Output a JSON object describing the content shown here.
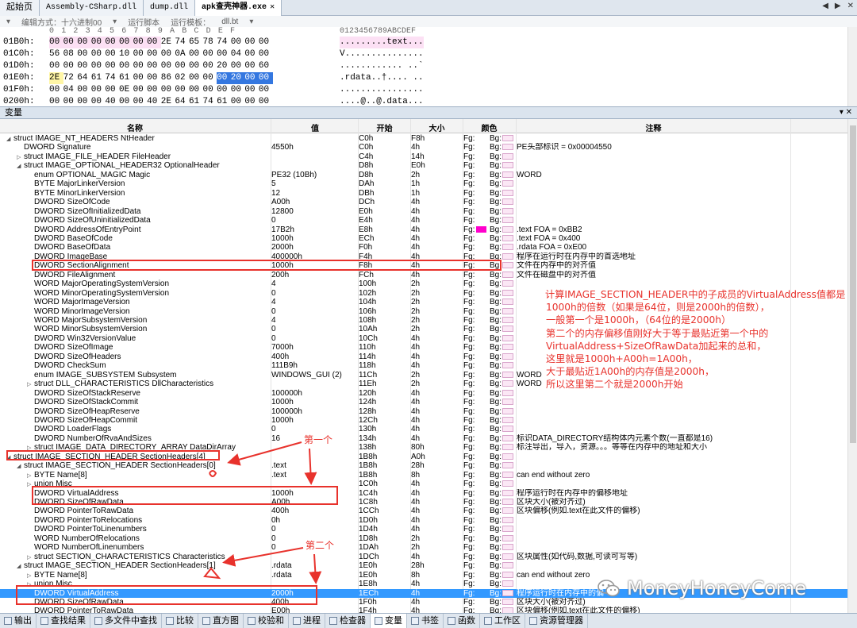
{
  "tabs": [
    {
      "label": "起始页",
      "active": false
    },
    {
      "label": "Assembly-CSharp.dll",
      "active": false
    },
    {
      "label": "dump.dll",
      "active": false
    },
    {
      "label": "apk查壳神器.exe",
      "active": true
    }
  ],
  "hex_toolbar": {
    "edit_mode": "编辑方式：十六进制00",
    "run_script": "运行脚本",
    "run_template": "运行模板：",
    "template_value": "dll.bt"
  },
  "hex": {
    "header_cols": "0  1  2  3  4  5  6  7  8  9  A  B  C  D  E  F",
    "header_ascii": "0123456789ABCDEF",
    "rows": [
      {
        "addr": "01B0h:",
        "bytes": [
          "00",
          "00",
          "00",
          "00",
          "00",
          "00",
          "00",
          "00",
          "2E",
          "74",
          "65",
          "78",
          "74",
          "00",
          "00",
          "00"
        ],
        "ascii": ".........text...",
        "style": "pink8"
      },
      {
        "addr": "01C0h:",
        "bytes": [
          "56",
          "08",
          "00",
          "00",
          "00",
          "10",
          "00",
          "00",
          "00",
          "0A",
          "00",
          "00",
          "00",
          "04",
          "00",
          "00"
        ],
        "ascii": "V...............",
        "style": "none"
      },
      {
        "addr": "01D0h:",
        "bytes": [
          "00",
          "00",
          "00",
          "00",
          "00",
          "00",
          "00",
          "00",
          "00",
          "00",
          "00",
          "00",
          "20",
          "00",
          "00",
          "60"
        ],
        "ascii": "............ ..`",
        "style": "none"
      },
      {
        "addr": "01E0h:",
        "bytes": [
          "2E",
          "72",
          "64",
          "61",
          "74",
          "61",
          "00",
          "00",
          "86",
          "02",
          "00",
          "00",
          "00",
          "20",
          "00",
          "00"
        ],
        "ascii": ".rdata..†.... ..",
        "style": "rdata"
      },
      {
        "addr": "01F0h:",
        "bytes": [
          "00",
          "04",
          "00",
          "00",
          "00",
          "0E",
          "00",
          "00",
          "00",
          "00",
          "00",
          "00",
          "00",
          "00",
          "00",
          "00"
        ],
        "ascii": "................",
        "style": "none"
      },
      {
        "addr": "0200h:",
        "bytes": [
          "00",
          "00",
          "00",
          "00",
          "40",
          "00",
          "00",
          "40",
          "2E",
          "64",
          "61",
          "74",
          "61",
          "00",
          "00",
          "00"
        ],
        "ascii": "....@..@.data...",
        "style": "none"
      }
    ]
  },
  "panel": {
    "title": "变量"
  },
  "columns": {
    "name": "名称",
    "value": "值",
    "start": "开始",
    "size": "大小",
    "color": "颜色",
    "comment": "注释"
  },
  "fg_label": "Fg:",
  "bg_label": "Bg:",
  "rows": [
    {
      "indent": 0,
      "tog": "open",
      "name": "struct IMAGE_NT_HEADERS NtHeader",
      "value": "",
      "start": "C0h",
      "size": "F8h",
      "comment": ""
    },
    {
      "indent": 1,
      "tog": "",
      "name": "DWORD Signature",
      "value": "4550h",
      "start": "C0h",
      "size": "4h",
      "comment": "PE头部标识 = 0x00004550"
    },
    {
      "indent": 1,
      "tog": "closed",
      "name": "struct IMAGE_FILE_HEADER FileHeader",
      "value": "",
      "start": "C4h",
      "size": "14h",
      "comment": ""
    },
    {
      "indent": 1,
      "tog": "open",
      "name": "struct IMAGE_OPTIONAL_HEADER32 OptionalHeader",
      "value": "",
      "start": "D8h",
      "size": "E0h",
      "comment": ""
    },
    {
      "indent": 2,
      "tog": "",
      "name": "enum OPTIONAL_MAGIC Magic",
      "value": "PE32 (10Bh)",
      "start": "D8h",
      "size": "2h",
      "comment": "WORD"
    },
    {
      "indent": 2,
      "tog": "",
      "name": "BYTE MajorLinkerVersion",
      "value": "5",
      "start": "DAh",
      "size": "1h",
      "comment": ""
    },
    {
      "indent": 2,
      "tog": "",
      "name": "BYTE MinorLinkerVersion",
      "value": "12",
      "start": "DBh",
      "size": "1h",
      "comment": ""
    },
    {
      "indent": 2,
      "tog": "",
      "name": "DWORD SizeOfCode",
      "value": "A00h",
      "start": "DCh",
      "size": "4h",
      "comment": ""
    },
    {
      "indent": 2,
      "tog": "",
      "name": "DWORD SizeOfInitializedData",
      "value": "12800",
      "start": "E0h",
      "size": "4h",
      "comment": ""
    },
    {
      "indent": 2,
      "tog": "",
      "name": "DWORD SizeOfUninitializedData",
      "value": "0",
      "start": "E4h",
      "size": "4h",
      "comment": ""
    },
    {
      "indent": 2,
      "tog": "",
      "name": "DWORD AddressOfEntryPoint",
      "value": "17B2h",
      "start": "E8h",
      "size": "4h",
      "comment": ".text FOA = 0xBB2",
      "fg": "#ff00cc"
    },
    {
      "indent": 2,
      "tog": "",
      "name": "DWORD BaseOfCode",
      "value": "1000h",
      "start": "ECh",
      "size": "4h",
      "comment": ".text FOA = 0x400"
    },
    {
      "indent": 2,
      "tog": "",
      "name": "DWORD BaseOfData",
      "value": "2000h",
      "start": "F0h",
      "size": "4h",
      "comment": ".rdata FOA = 0xE00"
    },
    {
      "indent": 2,
      "tog": "",
      "name": "DWORD ImageBase",
      "value": "400000h",
      "start": "F4h",
      "size": "4h",
      "comment": "程序在运行时在内存中的首选地址"
    },
    {
      "indent": 2,
      "tog": "",
      "name": "DWORD SectionAlignment",
      "value": "1000h",
      "start": "F8h",
      "size": "4h",
      "comment": "文件在内存中的对齐值"
    },
    {
      "indent": 2,
      "tog": "",
      "name": "DWORD FileAlignment",
      "value": "200h",
      "start": "FCh",
      "size": "4h",
      "comment": "文件在磁盘中的对齐值"
    },
    {
      "indent": 2,
      "tog": "",
      "name": "WORD MajorOperatingSystemVersion",
      "value": "4",
      "start": "100h",
      "size": "2h",
      "comment": ""
    },
    {
      "indent": 2,
      "tog": "",
      "name": "WORD MinorOperatingSystemVersion",
      "value": "0",
      "start": "102h",
      "size": "2h",
      "comment": ""
    },
    {
      "indent": 2,
      "tog": "",
      "name": "WORD MajorImageVersion",
      "value": "4",
      "start": "104h",
      "size": "2h",
      "comment": ""
    },
    {
      "indent": 2,
      "tog": "",
      "name": "WORD MinorImageVersion",
      "value": "0",
      "start": "106h",
      "size": "2h",
      "comment": ""
    },
    {
      "indent": 2,
      "tog": "",
      "name": "WORD MajorSubsystemVersion",
      "value": "4",
      "start": "108h",
      "size": "2h",
      "comment": ""
    },
    {
      "indent": 2,
      "tog": "",
      "name": "WORD MinorSubsystemVersion",
      "value": "0",
      "start": "10Ah",
      "size": "2h",
      "comment": ""
    },
    {
      "indent": 2,
      "tog": "",
      "name": "DWORD Win32VersionValue",
      "value": "0",
      "start": "10Ch",
      "size": "4h",
      "comment": ""
    },
    {
      "indent": 2,
      "tog": "",
      "name": "DWORD SizeOfImage",
      "value": "7000h",
      "start": "110h",
      "size": "4h",
      "comment": ""
    },
    {
      "indent": 2,
      "tog": "",
      "name": "DWORD SizeOfHeaders",
      "value": "400h",
      "start": "114h",
      "size": "4h",
      "comment": ""
    },
    {
      "indent": 2,
      "tog": "",
      "name": "DWORD CheckSum",
      "value": "111B9h",
      "start": "118h",
      "size": "4h",
      "comment": ""
    },
    {
      "indent": 2,
      "tog": "",
      "name": "enum IMAGE_SUBSYSTEM Subsystem",
      "value": "WINDOWS_GUI (2)",
      "start": "11Ch",
      "size": "2h",
      "comment": "WORD"
    },
    {
      "indent": 2,
      "tog": "closed",
      "name": "struct DLL_CHARACTERISTICS DllCharacteristics",
      "value": "",
      "start": "11Eh",
      "size": "2h",
      "comment": "WORD"
    },
    {
      "indent": 2,
      "tog": "",
      "name": "DWORD SizeOfStackReserve",
      "value": "100000h",
      "start": "120h",
      "size": "4h",
      "comment": ""
    },
    {
      "indent": 2,
      "tog": "",
      "name": "DWORD SizeOfStackCommit",
      "value": "1000h",
      "start": "124h",
      "size": "4h",
      "comment": ""
    },
    {
      "indent": 2,
      "tog": "",
      "name": "DWORD SizeOfHeapReserve",
      "value": "100000h",
      "start": "128h",
      "size": "4h",
      "comment": ""
    },
    {
      "indent": 2,
      "tog": "",
      "name": "DWORD SizeOfHeapCommit",
      "value": "1000h",
      "start": "12Ch",
      "size": "4h",
      "comment": ""
    },
    {
      "indent": 2,
      "tog": "",
      "name": "DWORD LoaderFlags",
      "value": "0",
      "start": "130h",
      "size": "4h",
      "comment": ""
    },
    {
      "indent": 2,
      "tog": "",
      "name": "DWORD NumberOfRvaAndSizes",
      "value": "16",
      "start": "134h",
      "size": "4h",
      "comment": "标识DATA_DIRECTORY结构体内元素个数(一直都是16)"
    },
    {
      "indent": 2,
      "tog": "closed",
      "name": "struct IMAGE_DATA_DIRECTORY_ARRAY DataDirArray",
      "value": "",
      "start": "138h",
      "size": "80h",
      "comment": "标注导出，导入，资源。。。等等在内存中的地址和大小"
    },
    {
      "indent": 0,
      "tog": "open",
      "name": "struct IMAGE_SECTION_HEADER SectionHeaders[4]",
      "value": "",
      "start": "1B8h",
      "size": "A0h",
      "comment": ""
    },
    {
      "indent": 1,
      "tog": "open",
      "name": "struct IMAGE_SECTION_HEADER SectionHeaders[0]",
      "value": ".text",
      "start": "1B8h",
      "size": "28h",
      "comment": ""
    },
    {
      "indent": 2,
      "tog": "closed",
      "name": "BYTE Name[8]",
      "value": ".text",
      "start": "1B8h",
      "size": "8h",
      "comment": "can end without zero"
    },
    {
      "indent": 2,
      "tog": "closed",
      "name": "union Misc",
      "value": "",
      "start": "1C0h",
      "size": "4h",
      "comment": ""
    },
    {
      "indent": 2,
      "tog": "",
      "name": "DWORD VirtualAddress",
      "value": "1000h",
      "start": "1C4h",
      "size": "4h",
      "comment": "程序运行时在内存中的偏移地址"
    },
    {
      "indent": 2,
      "tog": "",
      "name": "DWORD SizeOfRawData",
      "value": "A00h",
      "start": "1C8h",
      "size": "4h",
      "comment": "区块大小(被对齐过)"
    },
    {
      "indent": 2,
      "tog": "",
      "name": "DWORD PointerToRawData",
      "value": "400h",
      "start": "1CCh",
      "size": "4h",
      "comment": "区块偏移(例如.text在此文件的偏移)"
    },
    {
      "indent": 2,
      "tog": "",
      "name": "DWORD PointerToRelocations",
      "value": "0h",
      "start": "1D0h",
      "size": "4h",
      "comment": ""
    },
    {
      "indent": 2,
      "tog": "",
      "name": "DWORD PointerToLinenumbers",
      "value": "0",
      "start": "1D4h",
      "size": "4h",
      "comment": ""
    },
    {
      "indent": 2,
      "tog": "",
      "name": "WORD NumberOfRelocations",
      "value": "0",
      "start": "1D8h",
      "size": "2h",
      "comment": ""
    },
    {
      "indent": 2,
      "tog": "",
      "name": "WORD NumberOfLinenumbers",
      "value": "0",
      "start": "1DAh",
      "size": "2h",
      "comment": ""
    },
    {
      "indent": 2,
      "tog": "closed",
      "name": "struct SECTION_CHARACTERISTICS Characteristics",
      "value": "",
      "start": "1DCh",
      "size": "4h",
      "comment": "区块属性(如代码,数据,可读可写等)"
    },
    {
      "indent": 1,
      "tog": "open",
      "name": "struct IMAGE_SECTION_HEADER SectionHeaders[1]",
      "value": ".rdata",
      "start": "1E0h",
      "size": "28h",
      "comment": ""
    },
    {
      "indent": 2,
      "tog": "closed",
      "name": "BYTE Name[8]",
      "value": ".rdata",
      "start": "1E0h",
      "size": "8h",
      "comment": "can end without zero"
    },
    {
      "indent": 2,
      "tog": "closed",
      "name": "union Misc",
      "value": "",
      "start": "1E8h",
      "size": "4h",
      "comment": ""
    },
    {
      "indent": 2,
      "tog": "",
      "name": "DWORD VirtualAddress",
      "value": "2000h",
      "start": "1ECh",
      "size": "4h",
      "comment": "程序运行时在内存中的偏",
      "selected": true
    },
    {
      "indent": 2,
      "tog": "",
      "name": "DWORD SizeOfRawData",
      "value": "400h",
      "start": "1F0h",
      "size": "4h",
      "comment": "区块大小(被对齐过)"
    },
    {
      "indent": 2,
      "tog": "",
      "name": "DWORD PointerToRawData",
      "value": "E00h",
      "start": "1F4h",
      "size": "4h",
      "comment": "区块偏移(例如.text在此文件的偏移)"
    }
  ],
  "annotation": {
    "lines": [
      "计算IMAGE_SECTION_HEADER中的子成员的VirtualAddress值都是",
      "1000h的倍数（如果是64位，则是2000h的倍数），",
      "一般第一个是1000h，（64位的是2000h）",
      "第二个的内存偏移值刚好大于等于最贴近第一个中的",
      "VirtualAddress+SizeOfRawData加起来的总和，",
      "这里就是1000h+A00h=1A00h，",
      "大于最贴近1A00h的内存值是2000h，",
      "所以这里第二个就是2000h开始"
    ],
    "first_label": "第一个",
    "second_label": "第二个",
    "color": "#e8322c"
  },
  "watermark": {
    "text": "MoneyHoneyCome"
  },
  "bottom_tabs": [
    {
      "label": "输出",
      "icon": "output-icon"
    },
    {
      "label": "查找结果",
      "icon": "find-results-icon"
    },
    {
      "label": "多文件中查找",
      "icon": "find-in-files-icon"
    },
    {
      "label": "比较",
      "icon": "compare-icon"
    },
    {
      "label": "直方图",
      "icon": "histogram-icon"
    },
    {
      "label": "校验和",
      "icon": "checksum-icon"
    },
    {
      "label": "进程",
      "icon": "process-icon"
    },
    {
      "label": "检查器",
      "icon": "inspector-icon"
    },
    {
      "label": "变量",
      "icon": "variables-icon",
      "active": true
    },
    {
      "label": "书签",
      "icon": "bookmark-icon"
    },
    {
      "label": "函数",
      "icon": "function-icon"
    },
    {
      "label": "工作区",
      "icon": "workspace-icon"
    },
    {
      "label": "资源管理器",
      "icon": "explorer-icon"
    }
  ]
}
